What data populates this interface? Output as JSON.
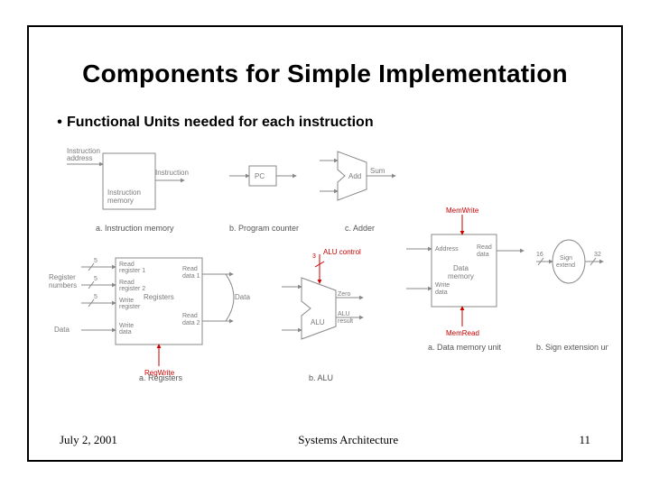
{
  "title": "Components for Simple Implementation",
  "bullet": "Functional Units needed for each instruction",
  "footer": {
    "date": "July 2, 2001",
    "course": "Systems Architecture",
    "page": "11"
  },
  "fig_a": {
    "in1": "Instruction",
    "in2": "address",
    "out": "Instruction",
    "box1": "Instruction",
    "box2": "memory",
    "caption": "a. Instruction memory"
  },
  "fig_b": {
    "label": "PC",
    "caption": "b. Program counter"
  },
  "fig_c": {
    "label": "Add",
    "out": "Sum",
    "caption": "c. Adder"
  },
  "fig_d": {
    "bus5": "5",
    "left0": "Register",
    "left1": "numbers",
    "left2": "Data",
    "p_read1a": "Read",
    "p_read1b": "register 1",
    "p_read2a": "Read",
    "p_read2b": "register 2",
    "p_wra": "Write",
    "p_wrb": "register",
    "p_wda": "Write",
    "p_wdb": "data",
    "mid": "Registers",
    "o_d1a": "Read",
    "o_d1b": "data 1",
    "o_d2a": "Read",
    "o_d2b": "data 2",
    "right": "Data",
    "ctrl": "RegWrite",
    "caption": "a. Registers"
  },
  "fig_e": {
    "ctrl": "ALU control",
    "bus3": "3",
    "label": "ALU",
    "zero": "Zero",
    "res1": "ALU",
    "res2": "result",
    "caption": "b. ALU"
  },
  "fig_f": {
    "top": "MemWrite",
    "in1": "Address",
    "in2a": "Write",
    "in2b": "data",
    "out1": "Read",
    "out2": "data",
    "mid1": "Data",
    "mid2": "memory",
    "bot": "MemRead",
    "caption": "a. Data memory unit"
  },
  "fig_g": {
    "in": "16",
    "out": "32",
    "lab1": "Sign",
    "lab2": "extend",
    "caption": "b. Sign extension unit"
  }
}
